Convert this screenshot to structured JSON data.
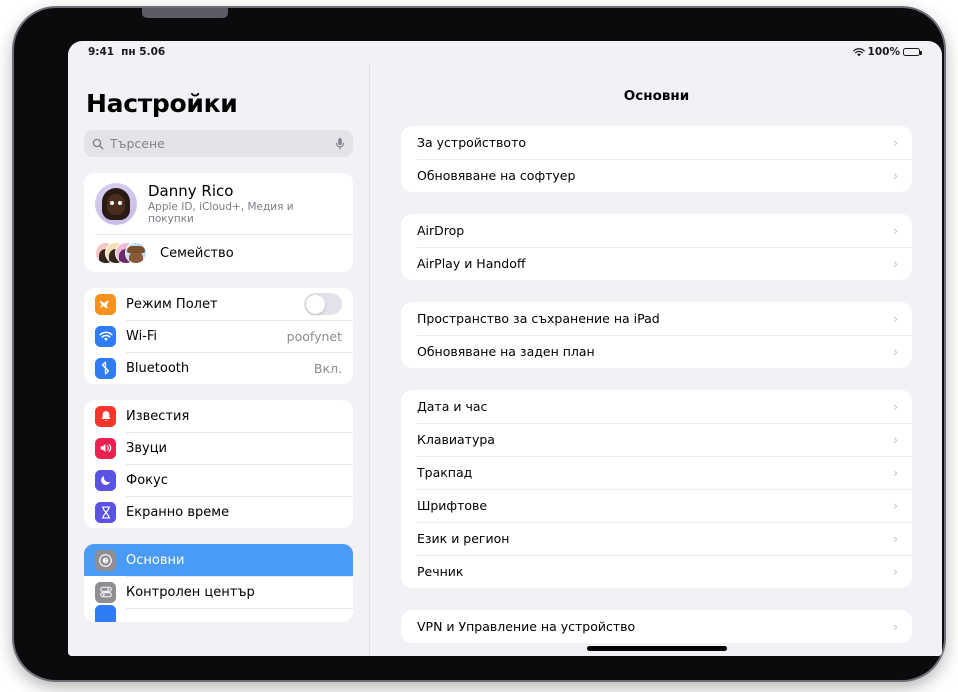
{
  "status_bar": {
    "time": "9:41",
    "date": "пн 5.06",
    "battery_percent": "100%",
    "wifi_icon": "wifi-icon",
    "battery_icon": "battery-icon"
  },
  "sidebar": {
    "title": "Настройки",
    "search": {
      "placeholder": "Търсене",
      "value": "",
      "search_icon": "search-icon",
      "mic_icon": "microphone-icon"
    },
    "account": {
      "name": "Danny Rico",
      "subtitle": "Apple ID, iCloud+, Медия и покупки",
      "avatar_icon": "memoji-avatar",
      "family_label": "Семейство",
      "family_avatars_icon": "family-memoji-stack"
    },
    "connectivity": [
      {
        "label": "Режим Полет",
        "icon": "airplane-icon",
        "icon_class": "ic-airplane",
        "glyph": "✈",
        "control": "toggle",
        "toggle_on": false,
        "value": ""
      },
      {
        "label": "Wi-Fi",
        "icon": "wifi-icon",
        "icon_class": "ic-wifi",
        "glyph": "●",
        "control": "value",
        "value": "poofynet"
      },
      {
        "label": "Bluetooth",
        "icon": "bluetooth-icon",
        "icon_class": "ic-bt",
        "glyph": "ᛦ",
        "control": "value",
        "value": "Вкл."
      }
    ],
    "alerts": [
      {
        "label": "Известия",
        "icon": "bell-icon",
        "icon_class": "ic-notif",
        "glyph": "ὑ4"
      },
      {
        "label": "Звуци",
        "icon": "speaker-icon",
        "icon_class": "ic-sound",
        "glyph": "◀"
      },
      {
        "label": "Фокус",
        "icon": "moon-icon",
        "icon_class": "ic-focus",
        "glyph": "☾"
      },
      {
        "label": "Екранно време",
        "icon": "hourglass-icon",
        "icon_class": "ic-screen",
        "glyph": "⧖"
      }
    ],
    "system": [
      {
        "label": "Основни",
        "icon": "gear-icon",
        "icon_class": "ic-general",
        "selected": true
      },
      {
        "label": "Контролен център",
        "icon": "control-center-icon",
        "icon_class": "ic-control",
        "selected": false
      }
    ]
  },
  "detail": {
    "title": "Основни",
    "chevron": "›",
    "groups": [
      {
        "name": "device-info-group",
        "rows": [
          {
            "label": "За устройството"
          },
          {
            "label": "Обновяване на софтуер"
          }
        ]
      },
      {
        "name": "sharing-group",
        "rows": [
          {
            "label": "AirDrop"
          },
          {
            "label": "AirPlay и Handoff"
          }
        ]
      },
      {
        "name": "storage-group",
        "rows": [
          {
            "label": "Пространство за съхранение на iPad"
          },
          {
            "label": "Обновяване на заден план"
          }
        ]
      },
      {
        "name": "preferences-group",
        "rows": [
          {
            "label": "Дата и час"
          },
          {
            "label": "Клавиатура"
          },
          {
            "label": "Тракпад"
          },
          {
            "label": "Шрифтове"
          },
          {
            "label": "Език и регион"
          },
          {
            "label": "Речник"
          }
        ]
      },
      {
        "name": "vpn-group",
        "rows": [
          {
            "label": "VPN и Управление на устройство"
          }
        ]
      }
    ]
  },
  "colors": {
    "accent_selected": "#4a9bf5",
    "screen_background": "#f2f1f6",
    "card_background": "#ffffff",
    "secondary_text": "#8b8a92"
  }
}
